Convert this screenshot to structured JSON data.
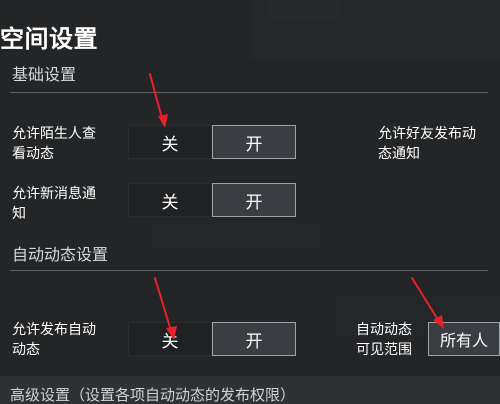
{
  "page": {
    "title": "空间设置"
  },
  "sections": {
    "basic": {
      "header": "基础设置"
    },
    "auto": {
      "header": "自动动态设置"
    },
    "advanced": {
      "header": "高级设置（设置各项自动动态的发布权限）"
    }
  },
  "settings": {
    "stranger_view": {
      "label_line1": "允许陌生人查",
      "label_line2": "看动态",
      "off_label": "关",
      "on_label": "开",
      "selected": "关"
    },
    "friend_notify": {
      "label_line1": "允许好友发布动",
      "label_line2": "态通知"
    },
    "new_message": {
      "label_line1": "允许新消息通",
      "label_line2": "知",
      "off_label": "关",
      "on_label": "开",
      "selected": "关"
    },
    "auto_post": {
      "label_line1": "允许发布自动",
      "label_line2": "动态",
      "off_label": "关",
      "on_label": "开",
      "selected": "关"
    },
    "auto_visibility": {
      "label_line1": "自动动态",
      "label_line2": "可见范围",
      "value": "所有人"
    }
  },
  "colors": {
    "annotation_arrow": "#e8202a",
    "selected_segment": "#1f2123",
    "unselected_segment": "#3a3e42"
  }
}
